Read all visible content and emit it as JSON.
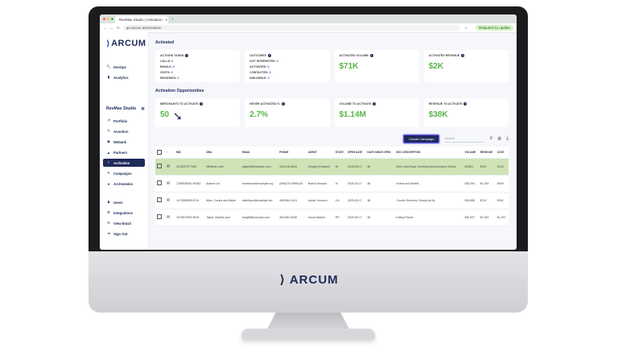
{
  "browser": {
    "tab_title": "RevMax Studio | Activation",
    "url": "qa.arcum.ai/activation",
    "relaunch_label": "Relaunch to update"
  },
  "brand": {
    "logo_text": "ARCUM",
    "logo_mark": "⟩"
  },
  "sidebar": {
    "top_items": [
      {
        "label": "DevOps",
        "icon": "wrench-icon",
        "glyph": "🔧"
      },
      {
        "label": "Analytics",
        "icon": "analytics-icon",
        "glyph": "▮"
      }
    ],
    "studio_label": "RevMax Studio",
    "studio_items": [
      {
        "label": "Portfolio",
        "icon": "trend-icon",
        "glyph": "↗",
        "active": false
      },
      {
        "label": "Annotion",
        "icon": "pencil-icon",
        "glyph": "✎",
        "active": false
      },
      {
        "label": "Webank",
        "icon": "bank-icon",
        "glyph": "◉",
        "active": false
      },
      {
        "label": "Partners",
        "icon": "partners-icon",
        "glyph": "▲",
        "active": false
      },
      {
        "label": "Activation",
        "icon": "activation-icon",
        "glyph": "⚡",
        "active": true
      },
      {
        "label": "Campaigns",
        "icon": "campaigns-icon",
        "glyph": "✈",
        "active": false
      },
      {
        "label": "Archimedes",
        "icon": "archimedes-icon",
        "glyph": "●",
        "active": false
      }
    ],
    "bottom_items": [
      {
        "label": "Users",
        "icon": "users-icon",
        "glyph": "♟"
      },
      {
        "label": "Integrations",
        "icon": "integrations-icon",
        "glyph": "⚙"
      },
      {
        "label": "View Email",
        "icon": "email-icon",
        "glyph": "✉"
      },
      {
        "label": "Sign Out",
        "icon": "signout-icon",
        "glyph": "⇥"
      }
    ]
  },
  "activated": {
    "title": "Activated",
    "actions_taken": {
      "label": "Actions Taken",
      "rows": [
        {
          "k": "CALLS:",
          "v": "0"
        },
        {
          "k": "EMAILS:",
          "v": "0"
        },
        {
          "k": "VISITS:",
          "v": "0"
        },
        {
          "k": "REVIEWED:",
          "v": "0"
        }
      ]
    },
    "outcomes": {
      "label": "Outcomes",
      "rows": [
        {
          "k": "NOT INTERESTED:",
          "v": "0"
        },
        {
          "k": "ACTIVATED:",
          "v": "0"
        },
        {
          "k": "CONTACTED:",
          "v": "0"
        },
        {
          "k": "INELIGIBLE:",
          "v": "0"
        }
      ]
    },
    "activated_volume": {
      "label": "Activated Volume",
      "value": "$71K"
    },
    "activated_revenue": {
      "label": "Activated Revenue",
      "value": "$2K"
    }
  },
  "opportunities": {
    "title": "Activation Opportunities",
    "merchants": {
      "label": "Merchants to Activate",
      "value": "50"
    },
    "never_activated": {
      "label": "Never Activated %",
      "value": "2.7%"
    },
    "volume": {
      "label": "Volume to Activate",
      "value": "$1.14M"
    },
    "revenue": {
      "label": "Revenue to Activate",
      "value": "$38K"
    }
  },
  "toolbar": {
    "create_label": "Create Campaign",
    "search_placeholder": "Search"
  },
  "table": {
    "headers": [
      "MID",
      "DBA",
      "EMAIL",
      "PHONE",
      "AGENT",
      "STATE",
      "OPEN DATE",
      "DAYS SINCE OPEN",
      "MCC DESCRIPTION",
      "VOLUME",
      "REVENUE",
      "COST"
    ],
    "rows": [
      {
        "highlight": true,
        "cells": [
          "1113057977906",
          "Williams Lane",
          "sptkpfd@example.com",
          "418-618-5844",
          "Gregory Edwards",
          "HI",
          "2025-05-17",
          "38",
          "Men's and Boys' Clothing and Accessory Stores",
          "$3,651",
          "$190",
          "$134"
        ]
      },
      {
        "highlight": false,
        "cells": [
          "7189505481 90363",
          "Adams Ltd",
          "eoexbsnw@example.org",
          "(469)074-9995x26",
          "Brandi Howard",
          "VI",
          "2025-05-17",
          "38",
          "Hotels and Motels",
          "$35,394",
          "$1,099",
          "$909"
        ]
      },
      {
        "highlight": false,
        "cells": [
          "1473983928 8714",
          "Allen, Cortez and Baker",
          "dtcehhpw@example.net",
          "458-564-1424",
          "Austin Johnson",
          "CA",
          "2025-05-17",
          "38",
          "Courier Services, Except by Air",
          "$25,658",
          "$742",
          "$342"
        ]
      },
      {
        "highlight": false,
        "cells": [
          "1575879593 6518",
          "Taylor, Stanley and",
          "fwryjfft@example.com",
          "363-852-5085",
          "Susan Barker",
          "PR",
          "2025-05-17",
          "38",
          "Eating Places",
          "$32,597",
          "$1,092",
          "$1,297"
        ]
      }
    ]
  }
}
